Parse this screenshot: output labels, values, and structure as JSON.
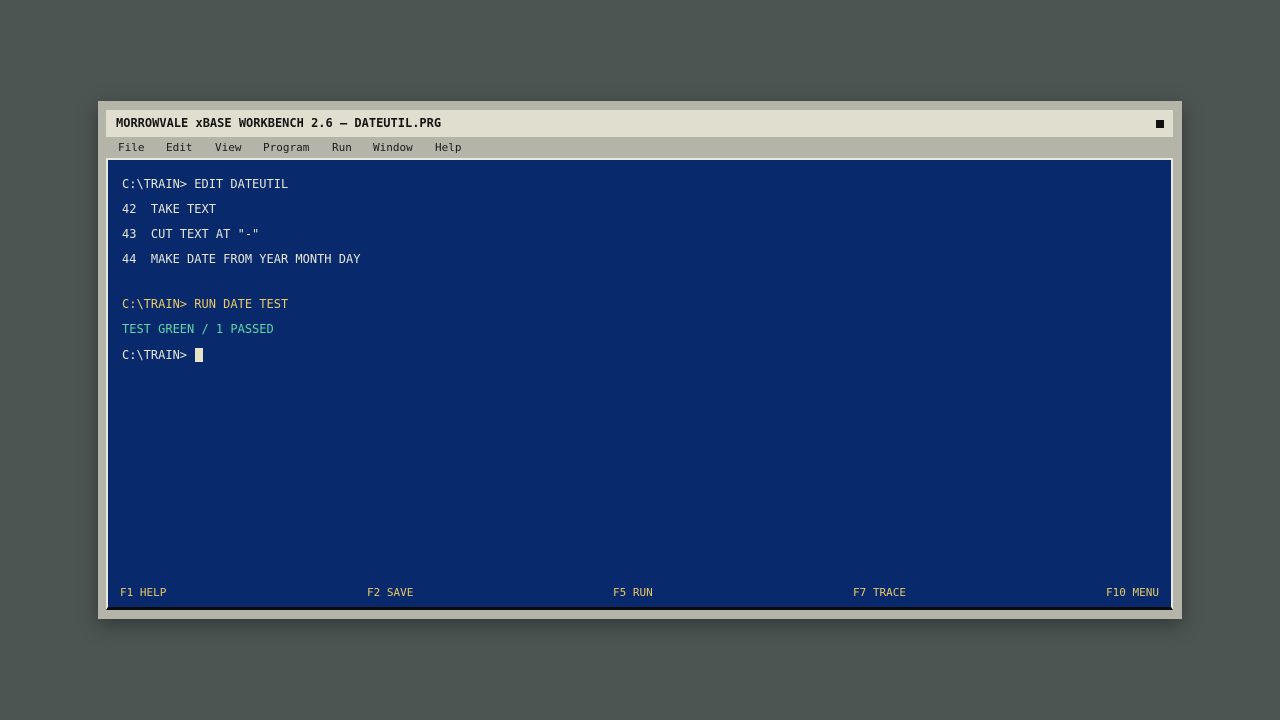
{
  "window": {
    "title": "MORROWVALE xBASE WORKBENCH 2.6 — DATEUTIL.PRG"
  },
  "menu": {
    "items": [
      {
        "label": "File"
      },
      {
        "label": "Edit"
      },
      {
        "label": "View"
      },
      {
        "label": "Program"
      },
      {
        "label": "Run"
      },
      {
        "label": "Window"
      },
      {
        "label": "Help"
      }
    ]
  },
  "console": {
    "lines": [
      {
        "text": "C:\\TRAIN> EDIT DATEUTIL",
        "color": "#e6e6dc"
      },
      {
        "text": "42  TAKE TEXT",
        "color": "#e6e6dc"
      },
      {
        "text": "43  CUT TEXT AT \"-\"",
        "color": "#e6e6dc"
      },
      {
        "text": "44  MAKE DATE FROM YEAR MONTH DAY",
        "color": "#e6e6dc"
      },
      {
        "text": "C:\\TRAIN> RUN DATE TEST",
        "color": "#e8c968"
      },
      {
        "text": "TEST GREEN / 1 PASSED",
        "color": "#5fd6a8"
      }
    ],
    "prompt": "C:\\TRAIN> "
  },
  "function_keys": [
    {
      "label": "F1 HELP"
    },
    {
      "label": "F2 SAVE"
    },
    {
      "label": "F5 RUN"
    },
    {
      "label": "F7 TRACE"
    },
    {
      "label": "F10 MENU"
    }
  ],
  "colors": {
    "screen_bg": "#08296b",
    "text_default": "#e6e6dc",
    "text_accent": "#e8c968",
    "text_success": "#5fd6a8"
  }
}
